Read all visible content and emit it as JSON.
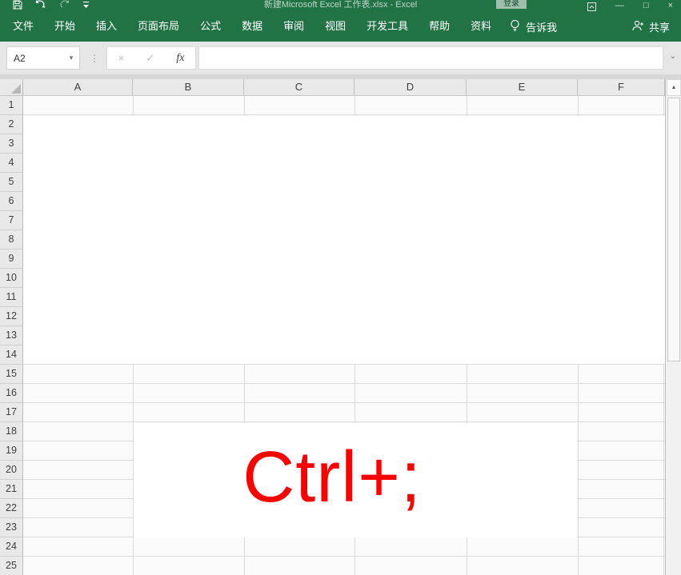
{
  "titlebar": {
    "title": "新建Microsoft Excel 工作表.xlsx  -  Excel",
    "signin_label": "登录",
    "qat_icons": [
      "save-icon",
      "undo-icon",
      "redo-icon",
      "customize-quick-access-icon"
    ],
    "window_controls": {
      "ribbon_options": "",
      "minimize": "—",
      "maximize": "□",
      "close": "×"
    }
  },
  "ribbon": {
    "tabs": [
      "文件",
      "开始",
      "插入",
      "页面布局",
      "公式",
      "数据",
      "审阅",
      "视图",
      "开发工具",
      "帮助",
      "资料"
    ],
    "tell_me_label": "告诉我",
    "share_label": "共享",
    "accent_color": "#217346"
  },
  "formula_bar": {
    "name_box_value": "A2",
    "cancel_glyph": "×",
    "enter_glyph": "✓",
    "fx_label": "fx",
    "formula_value": "",
    "dots": "⋮",
    "expand_glyph": "⌄"
  },
  "grid": {
    "column_headers": [
      "A",
      "B",
      "C",
      "D",
      "E",
      "F"
    ],
    "row_headers": [
      "1",
      "2",
      "3",
      "4",
      "5",
      "6",
      "7",
      "8",
      "9",
      "10",
      "11",
      "12",
      "13",
      "14",
      "15",
      "16",
      "17",
      "18",
      "19",
      "20",
      "21",
      "22",
      "23",
      "24",
      "25"
    ]
  },
  "annotation": {
    "text": "Ctrl+;",
    "color": "#fb0200"
  }
}
